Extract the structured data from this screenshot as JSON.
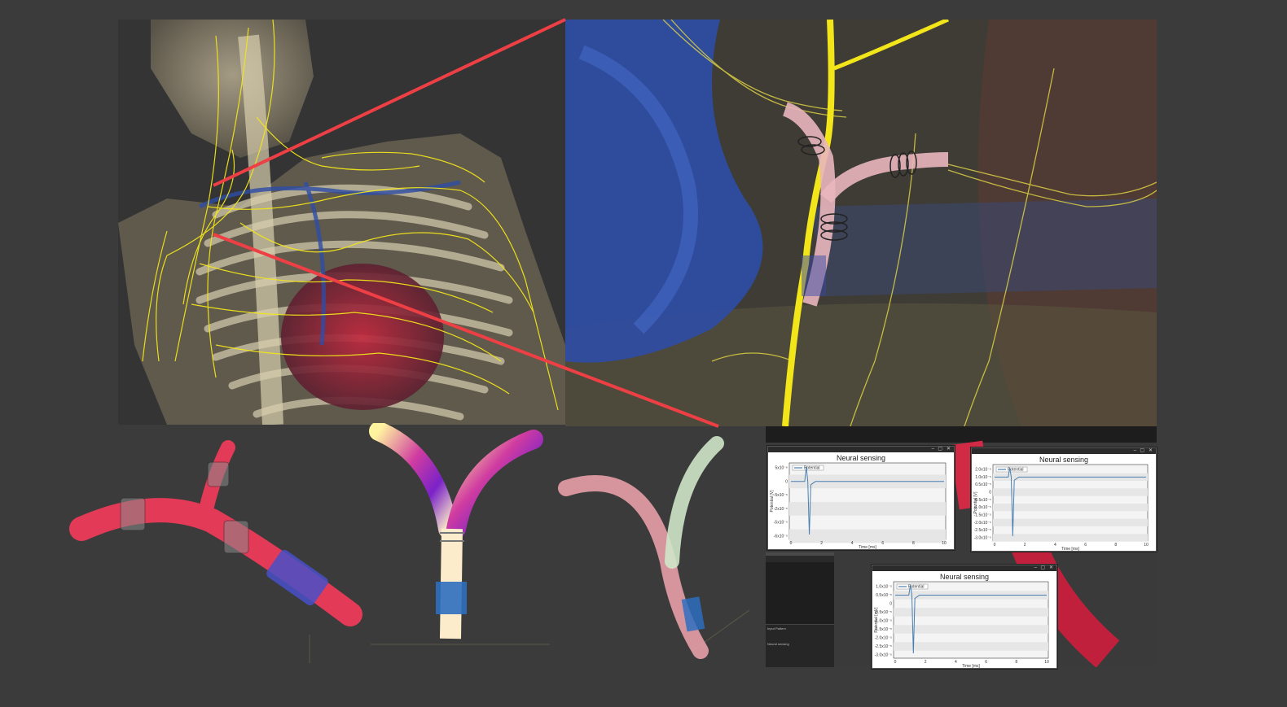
{
  "colors": {
    "background": "#3b3b3b",
    "nerve": "#f2e51a",
    "callout_line": "#ee3f45",
    "vein": "#2d4da6",
    "heart": "#b3253a",
    "cuff_red": "#e23a57",
    "cuff_blue": "#4850c8",
    "signal": "#4a7fb0"
  },
  "panels": {
    "anatomy_overview": {
      "icon": "thorax-nerve-anatomy-render"
    },
    "zoom_detail": {
      "icon": "nerve-cuff-electrode-zoom-render"
    },
    "model_red": {
      "icon": "cuff-electrode-model-render"
    },
    "model_heatmap": {
      "icon": "field-heatmap-render"
    },
    "model_fibers": {
      "icon": "fiber-model-render"
    }
  },
  "tool_window": {
    "labels": [
      "Input Pattern",
      "Neural sensing"
    ]
  },
  "plots": [
    {
      "title": "Neural sensing",
      "legend": "Potential",
      "xlabel": "Time [ms]",
      "ylabel": "Potential [V]",
      "xticks": [
        "0",
        "2",
        "4",
        "6",
        "8",
        "10"
      ],
      "yticks": [
        "5x10⁻⁶",
        "0",
        "-5x10⁻⁶",
        "-2x10⁻⁵",
        "-5x10⁻⁵",
        "-6x10⁻⁵"
      ]
    },
    {
      "title": "Neural sensing",
      "legend": "Potential",
      "xlabel": "Time [ms]",
      "ylabel": "Potential [V]",
      "xticks": [
        "0",
        "2",
        "4",
        "6",
        "8",
        "10"
      ],
      "yticks": [
        "2.0x10⁻⁵",
        "1.0x10⁻⁵",
        "0.5x10⁻⁵",
        "0",
        "-0.5x10⁻⁵",
        "-1.0x10⁻⁵",
        "-1.5x10⁻⁵",
        "-2.0x10⁻⁵",
        "-2.5x10⁻⁵",
        "-3.0x10⁻⁵"
      ]
    },
    {
      "title": "Neural sensing",
      "legend": "Potential",
      "xlabel": "Time [ms]",
      "ylabel": "Potential [mV]",
      "xticks": [
        "0",
        "2",
        "4",
        "6",
        "8",
        "10"
      ],
      "yticks": [
        "1.0x10⁻⁵",
        "0.5x10⁻⁵",
        "0",
        "-0.5x10⁻⁵",
        "-1.0x10⁻⁵",
        "-1.5x10⁻⁵",
        "-2.0x10⁻⁵",
        "-2.5x10⁻⁵",
        "-3.0x10⁻⁵"
      ]
    }
  ]
}
